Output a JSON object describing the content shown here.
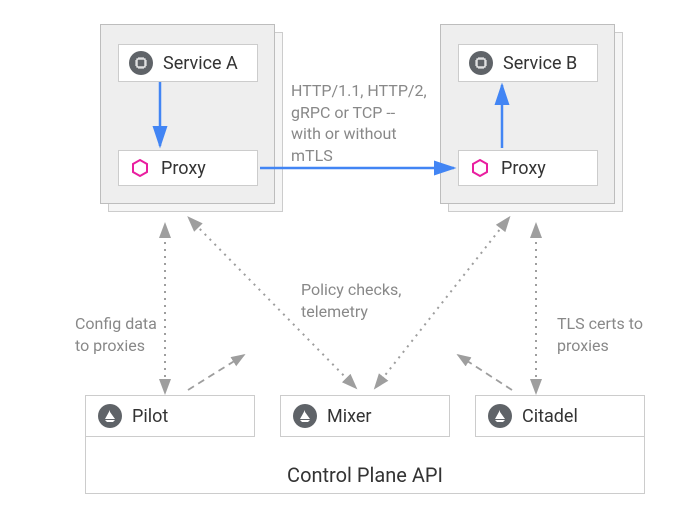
{
  "services": {
    "a": {
      "label": "Service A",
      "proxy_label": "Proxy"
    },
    "b": {
      "label": "Service B",
      "proxy_label": "Proxy"
    }
  },
  "control_plane": {
    "pilot": {
      "label": "Pilot"
    },
    "mixer": {
      "label": "Mixer"
    },
    "citadel": {
      "label": "Citadel"
    },
    "api_label": "Control Plane API"
  },
  "annotations": {
    "traffic": "HTTP/1.1, HTTP/2,\ngRPC or TCP --\nwith or without\nmTLS",
    "config": "Config data\nto proxies",
    "policy": "Policy checks,\ntelemetry",
    "tls": "TLS certs to\nproxies"
  }
}
